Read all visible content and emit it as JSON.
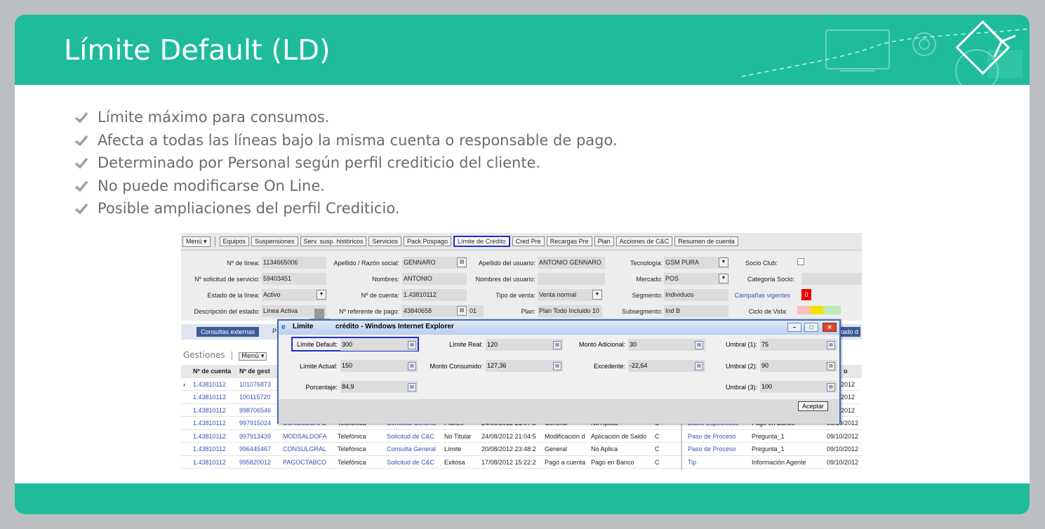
{
  "slide": {
    "title": "Límite Default (LD)",
    "bullets": [
      "Límite máximo para consumos.",
      "Afecta a todas las líneas bajo la misma cuenta o responsable de pago.",
      "Determinado por Personal según perfil crediticio del cliente.",
      "No puede modificarse On Line.",
      "Posible ampliaciones del perfil Crediticio."
    ]
  },
  "toolbar": {
    "menu": "Menú ▾",
    "buttons": [
      "Equipos",
      "Suspensiones",
      "Serv. susp. históricos",
      "Servicios",
      "Pack Pospago",
      "Límite de Crédito",
      "Cred Pre",
      "Recargas Pre",
      "Plan",
      "Acciones de C&C",
      "Resumen de cuenta"
    ]
  },
  "form": {
    "linea_lbl": "Nº de línea:",
    "linea": "1134665006",
    "apellido_lbl": "Apellido / Razón social:",
    "apellido": "GENNARO",
    "ap_usuario_lbl": "Apellido del usuario:",
    "ap_usuario": "ANTONIO GENNARO",
    "tecnologia_lbl": "Tecnología:",
    "tecnologia": "GSM PURA",
    "socio_lbl": "Socio Club:",
    "solicitud_lbl": "Nº solicitud de servicio:",
    "solicitud": "59403451",
    "nombres_lbl": "Nombres:",
    "nombres": "ANTONIO",
    "nom_usuario_lbl": "Nombres del usuario:",
    "mercado_lbl": "Mercado:",
    "mercado": "POS",
    "categoria_lbl": "Categoría Socio:",
    "estado_lbl": "Estado de la línea:",
    "estado": "Activo",
    "cuenta_lbl": "Nº de cuenta:",
    "cuenta": "1.43810112",
    "venta_lbl": "Tipo de venta:",
    "venta": "Venta normal",
    "segmento_lbl": "Segmento:",
    "segmento": "Individuos",
    "campanias": "Campañas vigentes",
    "campanias_badge": "0",
    "desc_lbl": "Descripción del estado:",
    "desc": "Línea Activa",
    "ref_lbl": "Nº referente de pago:",
    "ref": "43840658",
    "ref_extra": "01",
    "plan_lbl": "Plan:",
    "plan": "Plan Todo Incluido 10",
    "subseg_lbl": "Subsegmento:",
    "subseg": "Ind B",
    "ciclo_lbl": "Ciclo de Vida:"
  },
  "tabs": {
    "consultas": "Consultas externas",
    "p": "P",
    "estado": "tado d"
  },
  "gestiones": {
    "title": "Gestiones",
    "menu": "Menú ▾",
    "col1": "Nº de cuenta",
    "col2": "Nº de gest",
    "right_col": "o"
  },
  "rows": [
    {
      "cuenta": "1.43810112",
      "gest": "101076873"
    },
    {
      "cuenta": "1.43810112",
      "gest": "100115720"
    },
    {
      "cuenta": "1.43810112",
      "gest": "998706546"
    },
    {
      "cuenta": "1.43810112",
      "gest": "997915024",
      "cod": "CONSULGRAL",
      "emp": "Telefónica",
      "tipo": "Consulta General",
      "sub": "Planes",
      "fecha": "24/08/2012 21:07:3",
      "mot": "General",
      "res": "No Aplica",
      "c": "C"
    },
    {
      "cuenta": "1.43810112",
      "gest": "997913439",
      "cod": "MODSALDOFA",
      "emp": "Telefónica",
      "tipo": "Solicitud de C&C",
      "sub": "No Titular",
      "fecha": "24/08/2012 21:04:5",
      "mot": "Modificación d",
      "res": "Aplicación de Saldo",
      "c": "C"
    },
    {
      "cuenta": "1.43810112",
      "gest": "996445467",
      "cod": "CONSULGRAL",
      "emp": "Telefónica",
      "tipo": "Consulta General",
      "sub": "Límite",
      "fecha": "20/08/2012 23:48:2",
      "mot": "General",
      "res": "No Aplica",
      "c": "C"
    },
    {
      "cuenta": "1.43810112",
      "gest": "995820012",
      "cod": "PAGOCTABCO",
      "emp": "Telefónica",
      "tipo": "Solicitud de C&C",
      "sub": "Exitosa",
      "fecha": "17/08/2012 15:22:2",
      "mot": "Pago a cuenta",
      "res": "Pago en Banco",
      "c": "C"
    }
  ],
  "right_rows": [
    {
      "a": "",
      "b": "",
      "d": "0/10/2012"
    },
    {
      "a": "",
      "b": "",
      "d": "0/10/2012"
    },
    {
      "a": "",
      "b": "",
      "d": "0/10/2012"
    },
    {
      "a": "Datos Específicos",
      "b": "Pago en Banco",
      "d": "09/10/2012"
    },
    {
      "a": "Paso de Proceso",
      "b": "Pregunta_1",
      "d": "09/10/2012"
    },
    {
      "a": "Paso de Proceso",
      "b": "Pregunta_1",
      "d": "09/10/2012"
    },
    {
      "a": "Tip",
      "b": "Información Agente",
      "d": "09/10/2012"
    }
  ],
  "dialog": {
    "title": "Límite de crédito - Windows Internet Explorer",
    "title_visible": "Límite",
    "title_rest": "crédito - Windows Internet Explorer",
    "limite_default_lbl": "Límite Default:",
    "limite_default": "300",
    "limite_real_lbl": "Límite Real:",
    "limite_real": "120",
    "monto_adicional_lbl": "Monto Adicional:",
    "monto_adicional": "30",
    "umbral1_lbl": "Umbral (1):",
    "umbral1": "75",
    "limite_actual_lbl": "Límite Actual:",
    "limite_actual": "150",
    "monto_consumido_lbl": "Monto Consumido:",
    "monto_consumido": "127,36",
    "excedente_lbl": "Excedente:",
    "excedente": "-22,64",
    "umbral2_lbl": "Umbral (2):",
    "umbral2": "90",
    "porcentaje_lbl": "Porcentaje:",
    "porcentaje": "84,9",
    "umbral3_lbl": "Umbral (3):",
    "umbral3": "100",
    "aceptar": "Aceptar"
  },
  "colors": {
    "brand": "#1ebc9b",
    "link": "#3a52b5",
    "highlight": "#1e2fd0"
  }
}
